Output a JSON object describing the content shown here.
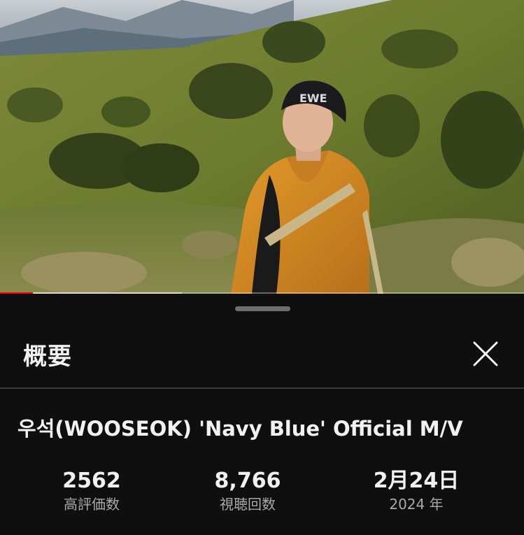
{
  "player": {
    "progress_fraction": 0.063,
    "accent_color": "#ff0000"
  },
  "sheet": {
    "title": "概要",
    "close_icon": "close-icon"
  },
  "video": {
    "title": "우석(WOOSEOK) 'Navy Blue' Official M/V",
    "beanie_text": "EWE"
  },
  "stats": {
    "likes_value": "2562",
    "likes_label": "高評価数",
    "views_value": "8,766",
    "views_label": "視聴回数",
    "date_value": "2月24日",
    "date_label": "2024 年"
  }
}
